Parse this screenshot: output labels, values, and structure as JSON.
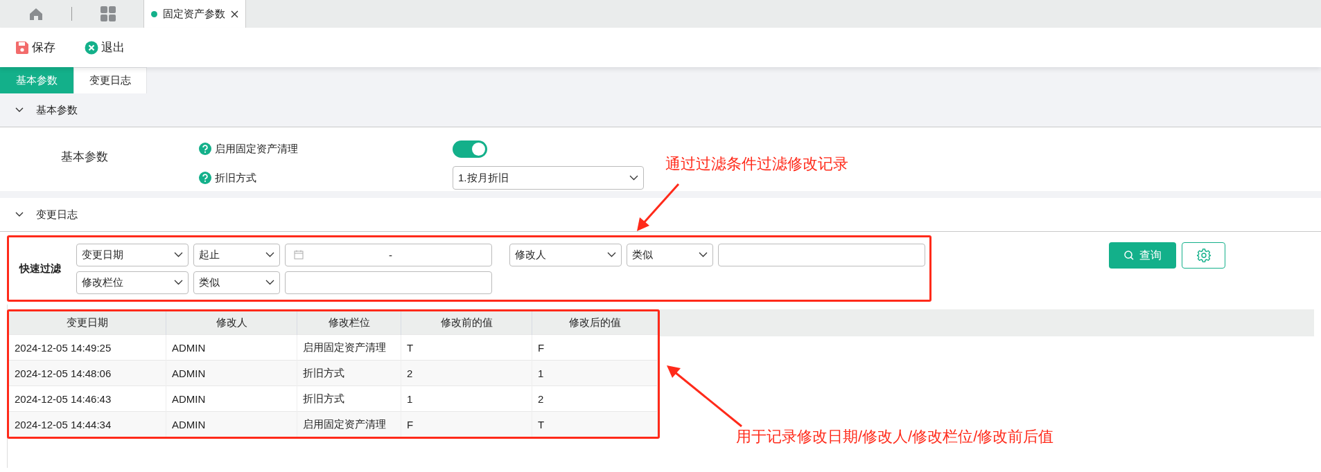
{
  "top_tabs": [
    {
      "kind": "home",
      "selected": false
    },
    {
      "kind": "apps",
      "selected": false
    },
    {
      "kind": "page",
      "label": "固定资产参数",
      "selected": true,
      "closable": true
    }
  ],
  "toolbar": [
    {
      "kind": "save",
      "label": "保存"
    },
    {
      "kind": "exit",
      "label": "退出"
    }
  ],
  "page_tabs": [
    {
      "label": "基本参数",
      "selected": true
    },
    {
      "label": "变更日志",
      "selected": false
    }
  ],
  "basic_section": {
    "title": "基本参数",
    "expanded": true,
    "group_label": "基本参数",
    "params": [
      {
        "kind": "toggle",
        "label": "启用固定资产清理",
        "on": true
      },
      {
        "kind": "select",
        "label": "折旧方式",
        "value": "1.按月折旧"
      }
    ]
  },
  "log_section": {
    "title": "变更日志",
    "expanded": true,
    "filter": {
      "label": "快速过滤",
      "conditions": [
        {
          "field": "变更日期",
          "operator": "起止",
          "kind": "daterange",
          "separator": "-"
        },
        {
          "field": "修改人",
          "operator": "类似",
          "kind": "text"
        },
        {
          "field": "修改栏位",
          "operator": "类似",
          "kind": "text"
        }
      ],
      "query_button": "查询"
    },
    "table": {
      "columns": [
        "变更日期",
        "修改人",
        "修改栏位",
        "修改前的值",
        "修改后的值"
      ],
      "rows": [
        [
          "2024-12-05 14:49:25",
          "ADMIN",
          "启用固定资产清理",
          "T",
          "F"
        ],
        [
          "2024-12-05 14:48:06",
          "ADMIN",
          "折旧方式",
          "2",
          "1"
        ],
        [
          "2024-12-05 14:46:43",
          "ADMIN",
          "折旧方式",
          "1",
          "2"
        ],
        [
          "2024-12-05 14:44:34",
          "ADMIN",
          "启用固定资产清理",
          "F",
          "T"
        ]
      ]
    }
  },
  "annotations": [
    {
      "kind": "filter",
      "text": "通过过滤条件过滤修改记录"
    },
    {
      "kind": "table",
      "text": "用于记录修改日期/修改人/修改栏位/修改前后值"
    }
  ]
}
